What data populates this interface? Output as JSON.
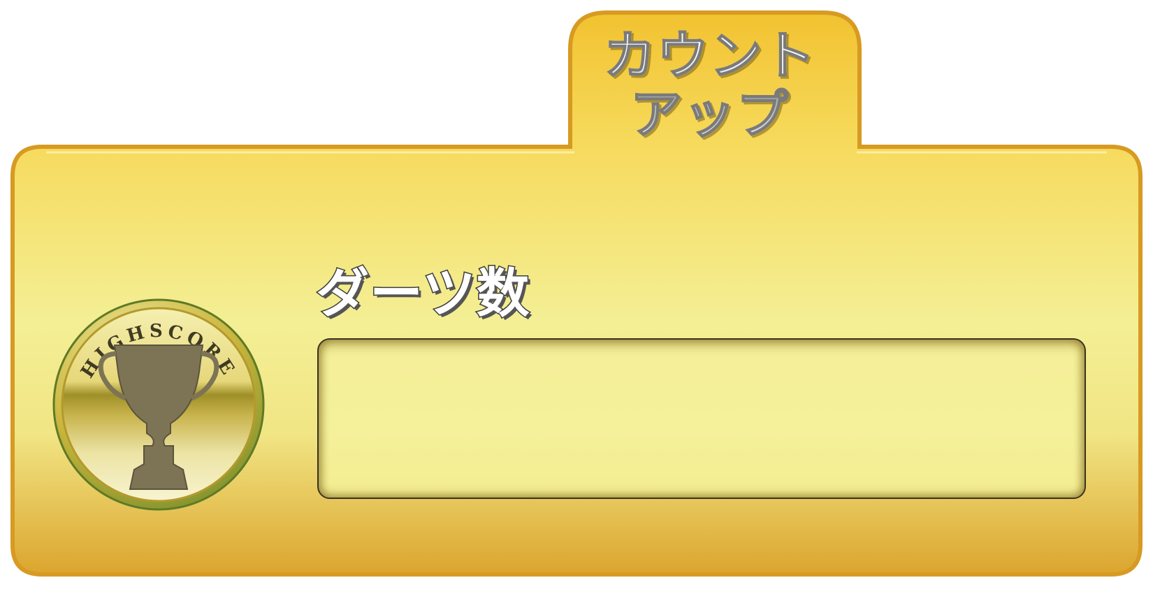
{
  "tab": {
    "title_line1": "カウント",
    "title_line2": "アップ"
  },
  "field": {
    "label": "ダーツ数",
    "value": ""
  },
  "medal": {
    "text": "HIGHSCORE"
  },
  "colors": {
    "panel_top": "#f6d34f",
    "panel_middle": "#f3ea8a",
    "panel_bottom": "#dcaa32",
    "panel_border": "#dba22a",
    "field_fill": "#f4ef97",
    "field_border": "#3b3222"
  },
  "icons": [
    "trophy-icon"
  ]
}
